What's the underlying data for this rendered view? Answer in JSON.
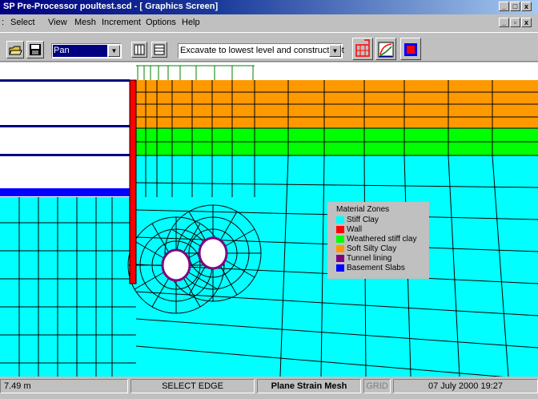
{
  "window": {
    "title": "SP Pre-Processor poultest.scd - [ Graphics Screen]",
    "controls": [
      "_",
      "□",
      "x"
    ],
    "child_controls": [
      "_",
      "▫",
      "x"
    ]
  },
  "menu": {
    "items": [
      "Select",
      "View",
      "Mesh",
      "Increment",
      "Options",
      "Help"
    ]
  },
  "toolbar": {
    "mode_value": "Pan",
    "increment_value": "Excavate to lowest level and construct bot",
    "dropdown_arrow": "▼"
  },
  "legend": {
    "title": "Material Zones",
    "entries": [
      {
        "label": "Stiff Clay",
        "color": "#00ffff"
      },
      {
        "label": "Wall",
        "color": "#ff0000"
      },
      {
        "label": "Weathered stiff clay",
        "color": "#00ff00"
      },
      {
        "label": "Soft Silty Clay",
        "color": "#ff9900"
      },
      {
        "label": "Tunnel lining",
        "color": "#800080"
      },
      {
        "label": "Basement Slabs",
        "color": "#0000ff"
      }
    ]
  },
  "status": {
    "coordinate": "7.49 m",
    "action": "SELECT EDGE",
    "mesh_type": "Plane Strain Mesh",
    "grid": "GRID",
    "datetime": "07 July 2000 19:27"
  },
  "colors": {
    "stiff_clay": "#00ffff",
    "wall": "#ff0000",
    "weathered": "#00ff00",
    "soft_silty": "#ff9900",
    "tunnel_lining": "#800080",
    "slab": "#0000ff",
    "load": "#008000"
  }
}
